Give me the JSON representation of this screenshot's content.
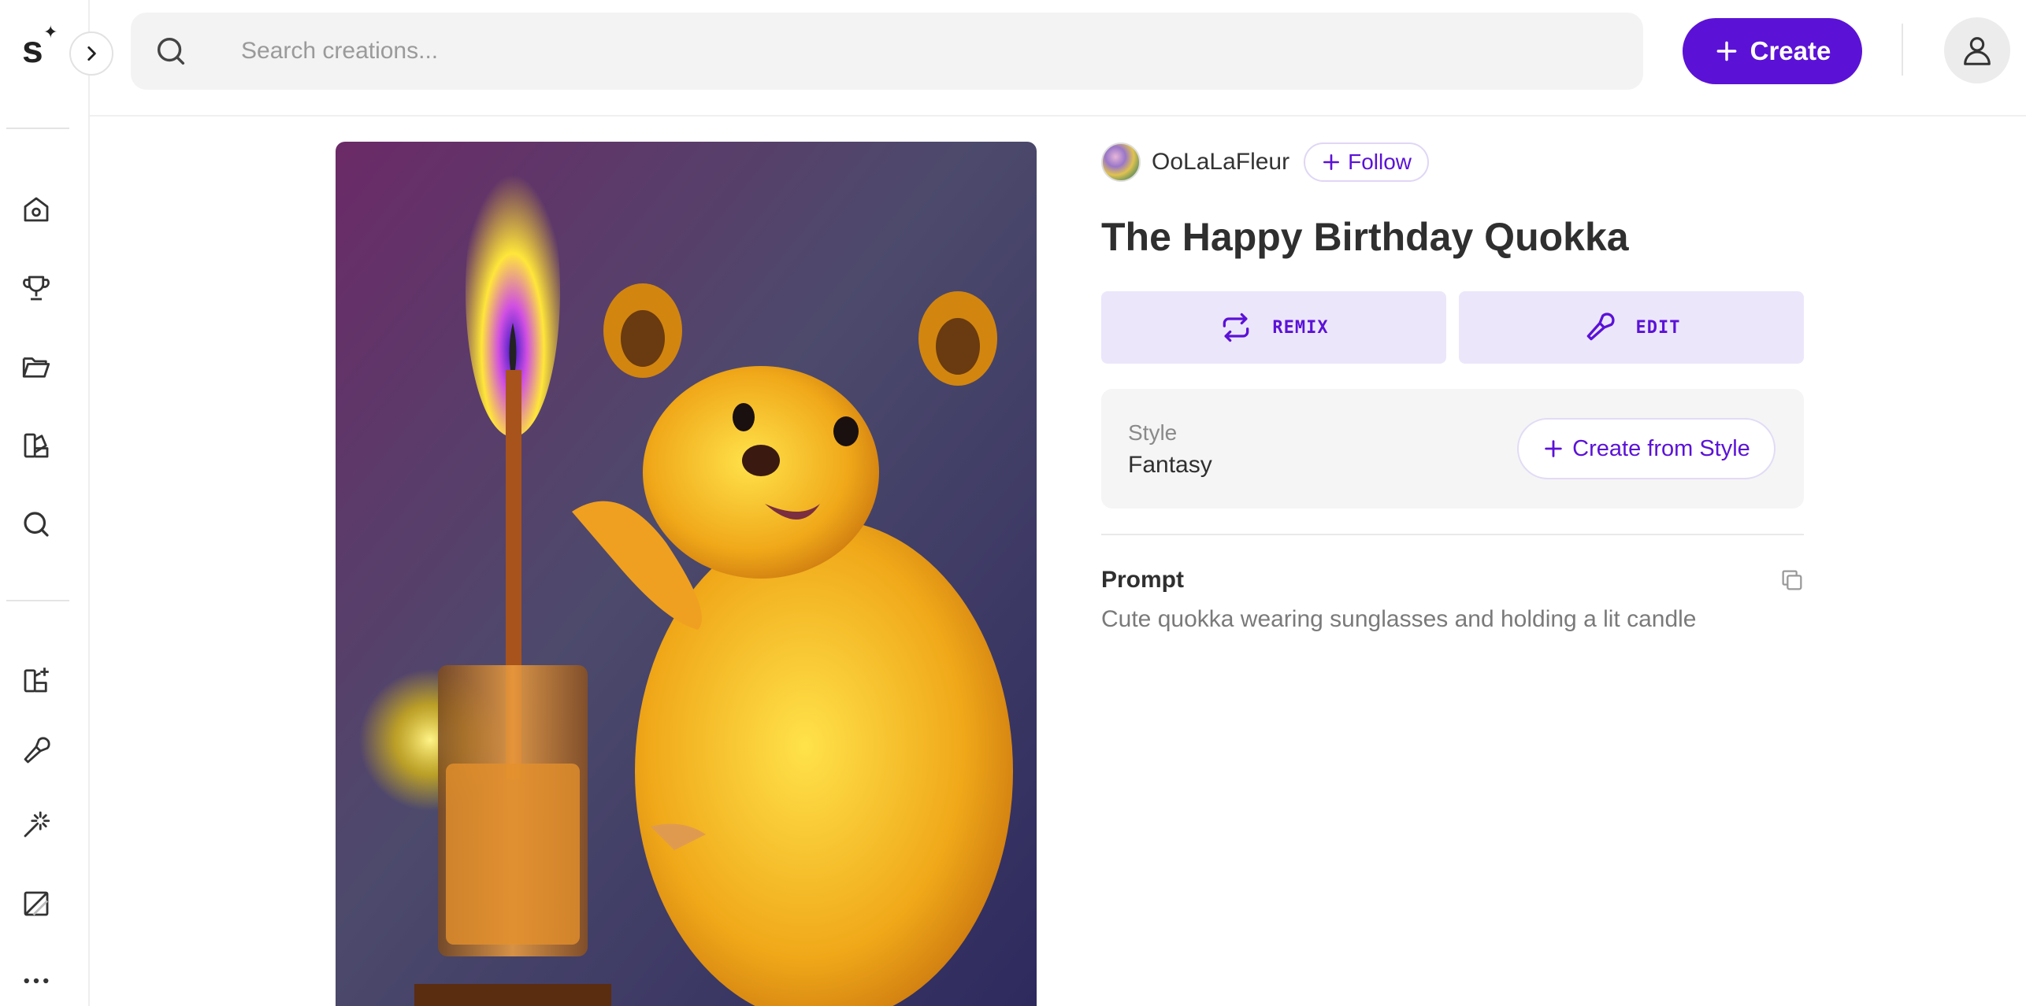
{
  "sidebar": {
    "logo_letter": "s",
    "items": [
      {
        "icon": "home-icon"
      },
      {
        "icon": "trophy-icon"
      },
      {
        "icon": "folder-icon"
      },
      {
        "icon": "styles-icon"
      },
      {
        "icon": "search-icon"
      },
      {
        "icon": "add-style-icon"
      },
      {
        "icon": "brush-icon"
      },
      {
        "icon": "magic-wand-icon"
      },
      {
        "icon": "canvas-icon"
      },
      {
        "icon": "more-icon"
      }
    ]
  },
  "topbar": {
    "search_placeholder": "Search creations...",
    "create_label": "Create"
  },
  "creation": {
    "author": "OoLaLaFleur",
    "follow_label": "Follow",
    "title": "The Happy Birthday Quokka",
    "remix_label": "REMIX",
    "edit_label": "EDIT",
    "style_label": "Style",
    "style_value": "Fantasy",
    "create_from_style_label": "Create from Style",
    "prompt_heading": "Prompt",
    "prompt_text": "Cute quokka wearing sunglasses and holding a lit candle"
  },
  "colors": {
    "accent": "#5b12d6",
    "accent_soft": "#ece6fb"
  }
}
